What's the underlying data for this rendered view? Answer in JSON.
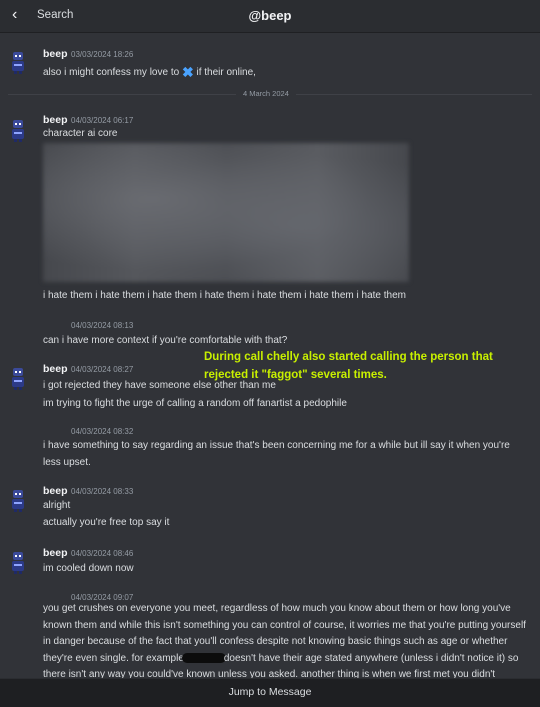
{
  "header": {
    "back_label": "Search",
    "title": "@beep"
  },
  "divider": {
    "label": "4 March 2024"
  },
  "messages": [
    {
      "author": "beep",
      "timestamp": "03/03/2024 18:26",
      "text_before": "also i might confess my love to",
      "text_after": "if their online,"
    },
    {
      "author": "beep",
      "timestamp": "04/03/2024 06:17",
      "text": "character ai core"
    },
    {
      "text": "i hate them i hate them i hate them i hate them i hate them i hate them i hate them"
    },
    {
      "timestamp": "04/03/2024 08:13",
      "text": "can i have more context if you're comfortable with that?"
    },
    {
      "author": "beep",
      "timestamp": "04/03/2024 08:27",
      "text": "i got rejected they have someone else other than me"
    },
    {
      "text": "im trying to fight the urge of calling a random off fanartist a pedophile"
    },
    {
      "timestamp": "04/03/2024 08:32",
      "text": "i have something to say regarding an issue that's been concerning me for a while but ill say it when you're less upset."
    },
    {
      "author": "beep",
      "timestamp": "04/03/2024 08:33",
      "text": "alright"
    },
    {
      "text": "actually you're free top say it"
    },
    {
      "author": "beep",
      "timestamp": "04/03/2024 08:46",
      "text": "im cooled down now"
    },
    {
      "timestamp": "04/03/2024 09:07",
      "text_before": "you get crushes on everyone you meet, regardless of how much you know about them or how long you've known them and while this isn't something you can control of course, it worries me that you're putting yourself in danger because of the fact that you'll confess despite not knowing basic things such as age or whether they're even single. for example",
      "text_after": "doesn't have their age stated anywhere (unless i didn't notice it) so there isn't any way you could've known unless you asked. another thing is when we first met you didn't"
    }
  ],
  "overlay_note": {
    "line1": "During call chelly also started calling the person that",
    "line2": "rejected it \"faggot\" several times."
  },
  "footer": {
    "jump_label": "Jump to Message"
  },
  "colors": {
    "background": "#313338",
    "header": "#2b2d31",
    "overlay_text": "#c8f000"
  }
}
